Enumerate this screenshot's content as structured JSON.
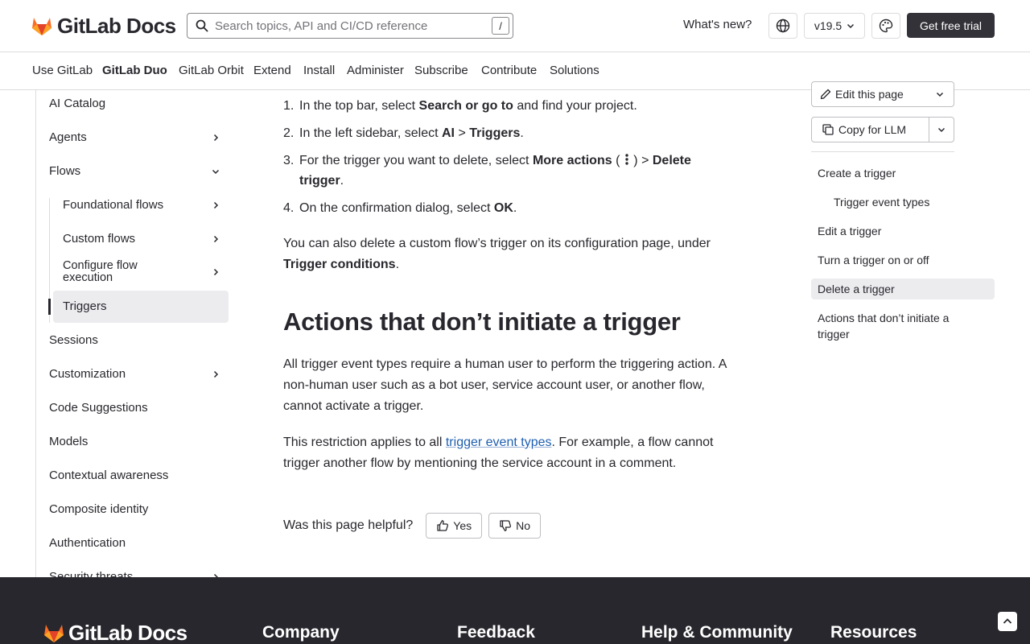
{
  "header": {
    "logo_text": "GitLab Docs",
    "search_placeholder": "Search topics, API and CI/CD reference",
    "search_shortcut": "/",
    "whats_new": "What's new?",
    "version": "v19.5",
    "trial_label": "Get free trial"
  },
  "nav": {
    "items": [
      "Use GitLab",
      "GitLab Duo",
      "GitLab Orbit",
      "Extend",
      "Install",
      "Administer",
      "Subscribe",
      "Contribute",
      "Solutions"
    ],
    "active": "GitLab Duo"
  },
  "sidebar": {
    "items": [
      {
        "label": "AI Catalog"
      },
      {
        "label": "Agents"
      },
      {
        "label": "Flows"
      },
      {
        "label": "Foundational flows"
      },
      {
        "label": "Custom flows"
      },
      {
        "label": "Configure flow execution"
      },
      {
        "label": "Triggers"
      },
      {
        "label": "Sessions"
      },
      {
        "label": "Customization"
      },
      {
        "label": "Code Suggestions"
      },
      {
        "label": "Models"
      },
      {
        "label": "Contextual awareness"
      },
      {
        "label": "Composite identity"
      },
      {
        "label": "Authentication"
      },
      {
        "label": "Security threats"
      }
    ]
  },
  "content": {
    "steps": [
      {
        "num": "1.",
        "pre": "In the top bar, select ",
        "b1": "Search or go to",
        "post": " and find your project."
      },
      {
        "num": "2.",
        "pre": "In the left sidebar, select ",
        "b1": "AI",
        "mid": " > ",
        "b2": "Triggers",
        "post": "."
      },
      {
        "num": "3.",
        "pre": "For the trigger you want to delete, select ",
        "b1": "More actions",
        "mid1": " ( ",
        "mid2": " ) > ",
        "b2": "Delete",
        "b3": "trigger",
        "post": "."
      },
      {
        "num": "4.",
        "pre": "On the confirmation dialog, select ",
        "b1": "OK",
        "post": "."
      }
    ],
    "para1_pre": "You can also delete a custom flow’s trigger on its configuration page, under",
    "para1_bold": "Trigger conditions",
    "para1_post": ".",
    "heading": "Actions that don’t initiate a trigger",
    "para2": "All trigger event types require a human user to perform the triggering action. A non-human user such as a bot user, service account user, or another flow, cannot activate a trigger.",
    "para3_pre": "This restriction applies to all ",
    "para3_link": "trigger event types",
    "para3_post": ". For example, a flow cannot trigger another flow by mentioning the service account in a comment.",
    "helpful_q": "Was this page helpful?",
    "yes": "Yes",
    "no": "No"
  },
  "toc": {
    "edit_label": "Edit this page",
    "copy_label": "Copy for LLM",
    "items": [
      {
        "label": "Create a trigger"
      },
      {
        "label": "Trigger event types"
      },
      {
        "label": "Edit a trigger"
      },
      {
        "label": "Turn a trigger on or off"
      },
      {
        "label": "Delete a trigger"
      },
      {
        "label": "Actions that don’t initiate a trigger"
      }
    ]
  },
  "footer": {
    "logo_text": "GitLab Docs",
    "columns": [
      "Company",
      "Feedback",
      "Help & Community",
      "Resources"
    ]
  },
  "colors": {
    "brand_orange": "#fc6d26",
    "brand_dark": "#28272d",
    "link": "#1f5fb0"
  }
}
